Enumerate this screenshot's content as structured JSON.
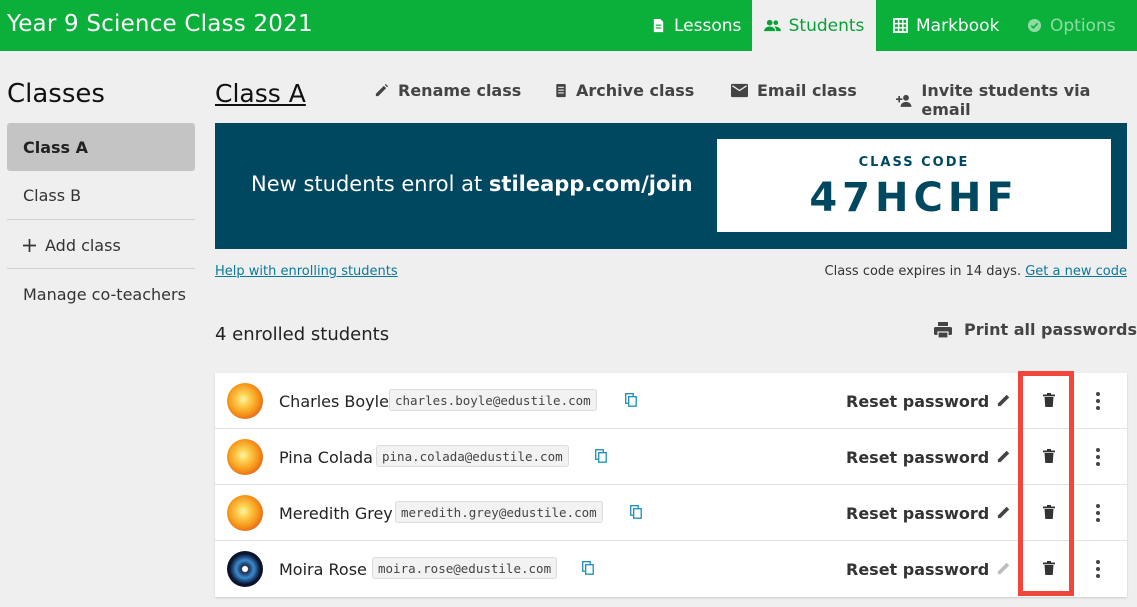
{
  "header": {
    "title": "Year 9 Science Class 2021",
    "tabs": [
      {
        "label": "Lessons",
        "icon": "document-icon"
      },
      {
        "label": "Students",
        "icon": "people-icon",
        "active": true
      },
      {
        "label": "Markbook",
        "icon": "grid-icon"
      },
      {
        "label": "Options",
        "icon": "check-circle-icon"
      }
    ]
  },
  "sidebar": {
    "title": "Classes",
    "items": [
      {
        "label": "Class A",
        "active": true
      },
      {
        "label": "Class B"
      },
      {
        "label": "Add class",
        "icon": "plus-icon"
      },
      {
        "label": "Manage co-teachers"
      }
    ]
  },
  "main": {
    "class_title": "Class A",
    "actions": [
      {
        "label": "Rename class",
        "icon": "pencil-icon"
      },
      {
        "label": "Archive class",
        "icon": "archive-icon"
      },
      {
        "label": "Email class",
        "icon": "envelope-icon"
      },
      {
        "label": "Invite students via email",
        "icon": "person-add-icon"
      }
    ],
    "banner": {
      "text_prefix": "New students enrol at ",
      "url": "stileapp.com/join",
      "code_label": "CLASS CODE",
      "code": "47HCHF"
    },
    "help_link": "Help with enrolling students",
    "expiry_text": "Class code expires in 14 days.",
    "new_code_link": "Get a new code",
    "enrolled_count": "4 enrolled students",
    "print_label": "Print all passwords"
  },
  "students": [
    {
      "name": "Charles Boyle",
      "email": "charles.boyle@edustile.com",
      "reset_label": "Reset password",
      "avatar": "sun"
    },
    {
      "name": "Pina Colada",
      "email": "pina.colada@edustile.com",
      "reset_label": "Reset password",
      "avatar": "sun"
    },
    {
      "name": "Meredith Grey",
      "email": "meredith.grey@edustile.com",
      "reset_label": "Reset password",
      "avatar": "sun"
    },
    {
      "name": "Moira Rose",
      "email": "moira.rose@edustile.com",
      "reset_label": "Reset password",
      "avatar": "disc"
    }
  ],
  "colors": {
    "brand_green": "#0bb03a",
    "banner_blue": "#004760",
    "highlight_red": "#f0463c",
    "link": "#0a7a9a"
  }
}
